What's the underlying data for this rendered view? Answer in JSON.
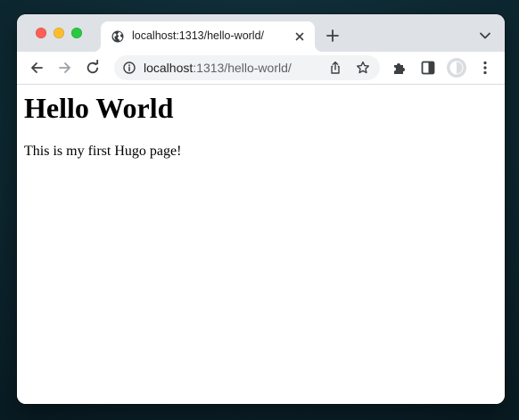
{
  "browser": {
    "tab": {
      "title": "localhost:1313/hello-world/",
      "favicon": "globe-icon"
    },
    "omnibox": {
      "host": "localhost",
      "path": ":1313/hello-world/"
    },
    "icons": {
      "back": "arrow-left-icon",
      "forward": "arrow-right-icon",
      "reload": "reload-icon",
      "info": "info-icon",
      "share": "share-icon",
      "bookmark": "star-icon",
      "extensions": "puzzle-icon",
      "side_panel": "side-panel-icon",
      "profile": "avatar-icon",
      "menu": "kebab-menu-icon",
      "new_tab": "plus-icon",
      "tab_search": "chevron-down-icon",
      "close_tab": "close-icon"
    },
    "colors": {
      "tabstrip": "#dee1e6",
      "omnibox": "#f1f3f4",
      "traffic_close": "#ff5f57",
      "traffic_minimize": "#febc2e",
      "traffic_maximize": "#28c840"
    }
  },
  "page": {
    "heading": "Hello World",
    "paragraph": "This is my first Hugo page!"
  }
}
